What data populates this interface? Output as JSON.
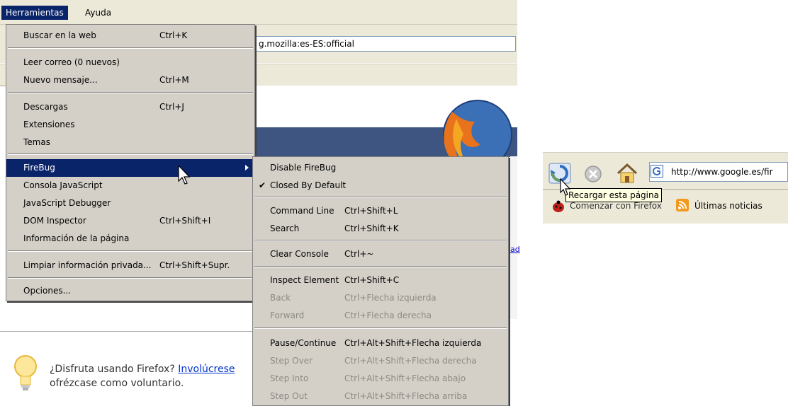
{
  "menubar": {
    "tools": "Herramientas",
    "help": "Ayuda"
  },
  "url_partial": "g.mozilla:es-ES:official",
  "link_fragment": "ad",
  "tools_menu": {
    "items": [
      {
        "label": "Buscar en la web",
        "accel": "Ctrl+K"
      },
      {
        "label": "Leer correo (0 nuevos)",
        "accel": ""
      },
      {
        "label": "Nuevo mensaje...",
        "accel": "Ctrl+M"
      },
      {
        "label": "Descargas",
        "accel": "Ctrl+J"
      },
      {
        "label": "Extensiones",
        "accel": ""
      },
      {
        "label": "Temas",
        "accel": ""
      },
      {
        "label": "FireBug",
        "accel": ""
      },
      {
        "label": "Consola JavaScript",
        "accel": ""
      },
      {
        "label": "JavaScript Debugger",
        "accel": ""
      },
      {
        "label": "DOM Inspector",
        "accel": "Ctrl+Shift+I"
      },
      {
        "label": "Información de la página",
        "accel": ""
      },
      {
        "label": "Limpiar información privada...",
        "accel": "Ctrl+Shift+Supr."
      },
      {
        "label": "Opciones...",
        "accel": ""
      }
    ]
  },
  "firebug_menu": {
    "check_mark": "✔",
    "items": [
      {
        "label": "Disable FireBug",
        "accel": ""
      },
      {
        "label": "Closed By Default",
        "accel": ""
      },
      {
        "label": "Command Line",
        "accel": "Ctrl+Shift+L"
      },
      {
        "label": "Search",
        "accel": "Ctrl+Shift+K"
      },
      {
        "label": "Clear Console",
        "accel": "Ctrl+~"
      },
      {
        "label": "Inspect Element",
        "accel": "Ctrl+Shift+C"
      },
      {
        "label": "Back",
        "accel": "Ctrl+Flecha izquierda"
      },
      {
        "label": "Forward",
        "accel": "Ctrl+Flecha derecha"
      },
      {
        "label": "Pause/Continue",
        "accel": "Ctrl+Alt+Shift+Flecha izquierda"
      },
      {
        "label": "Step Over",
        "accel": "Ctrl+Alt+Shift+Flecha derecha"
      },
      {
        "label": "Step Into",
        "accel": "Ctrl+Alt+Shift+Flecha abajo"
      },
      {
        "label": "Step Out",
        "accel": "Ctrl+Alt+Shift+Flecha arriba"
      }
    ]
  },
  "tip": {
    "text_before": "¿Disfruta usando Firefox? ",
    "link": "Involúcrese",
    "line2": "ofrézcase como voluntario."
  },
  "right_panel": {
    "url": "http://www.google.es/fir",
    "tooltip": "Recargar esta página",
    "bookmark1": "Comenzar con Firefox",
    "bookmark2": "Últimas noticias"
  },
  "colors": {
    "menu_bg": "#d4d0c8",
    "highlight": "#0a246a",
    "toolbar_bg": "#ece9d8",
    "tooltip_bg": "#ffffe1"
  }
}
